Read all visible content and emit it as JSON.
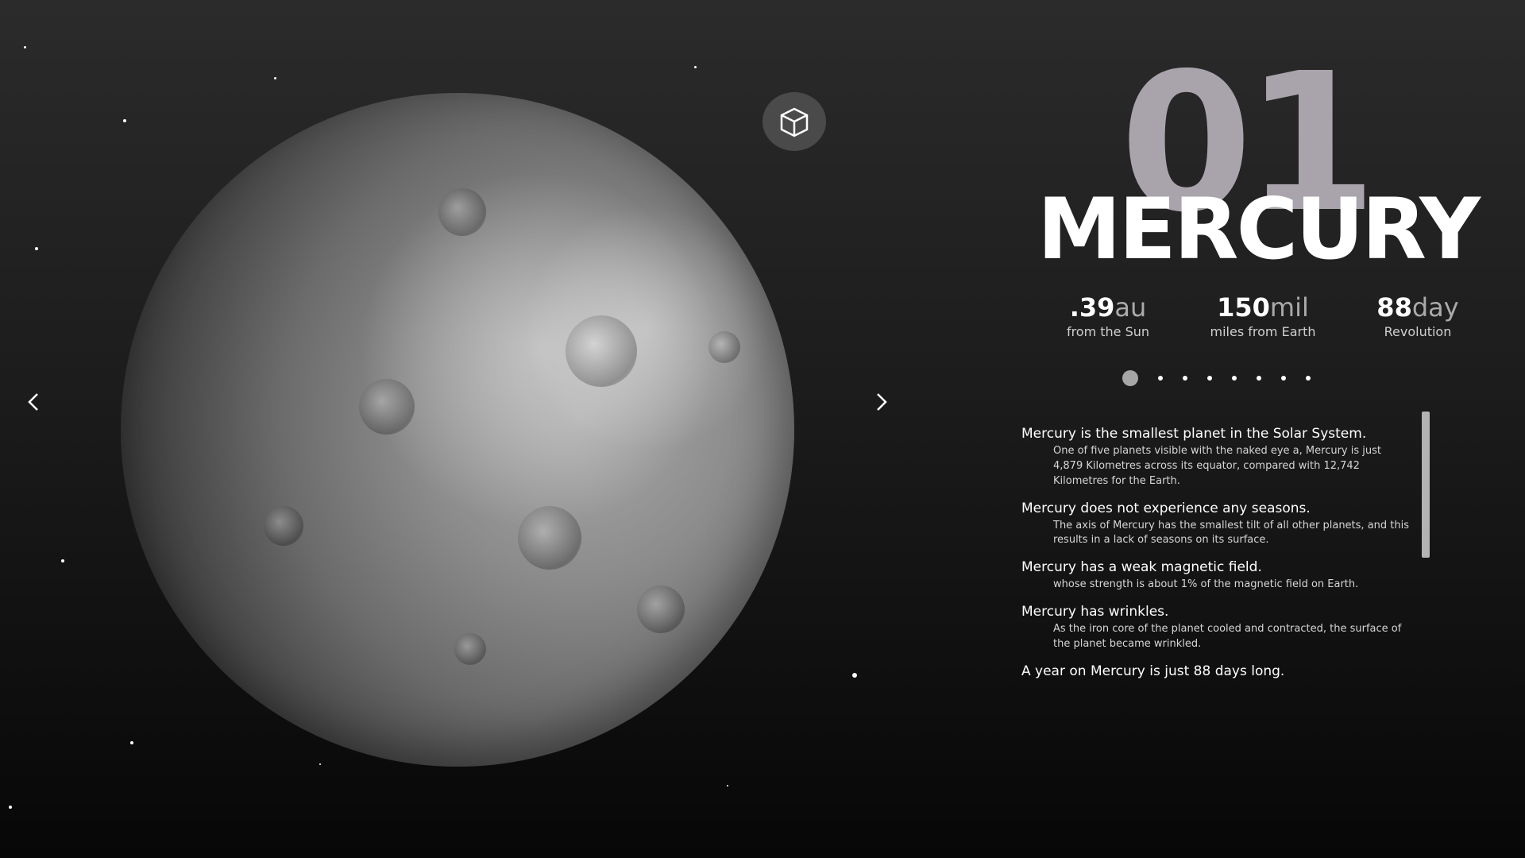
{
  "planet": {
    "number": "01",
    "name": "MERCURY"
  },
  "stats": [
    {
      "value": ".39",
      "unit": "au",
      "label": "from the Sun"
    },
    {
      "value": "150",
      "unit": "mil",
      "label": "miles from Earth"
    },
    {
      "value": "88",
      "unit": "day",
      "label": "Revolution"
    }
  ],
  "view_toggle": {
    "label": "3D",
    "icon": "cube-3d-icon"
  },
  "nav": {
    "prev_icon": "chevron-left-icon",
    "next_icon": "chevron-right-icon"
  },
  "pagination": {
    "total": 8,
    "active": 1
  },
  "facts": [
    {
      "title": "Mercury is the smallest planet in the Solar System.",
      "desc": "One of five planets visible with the naked eye a, Mercury is just 4,879 Kilometres across its equator, compared with 12,742 Kilometres for the Earth."
    },
    {
      "title": "Mercury does not experience any seasons.",
      "desc": "The axis of Mercury has the smallest tilt of all other planets, and this results in a lack of seasons on its surface."
    },
    {
      "title": "Mercury has a weak magnetic field.",
      "desc": "whose strength is about 1% of the magnetic field on Earth."
    },
    {
      "title": "Mercury has wrinkles.",
      "desc": "As the iron core of the planet cooled and contracted, the surface of the planet became wrinkled."
    },
    {
      "title": "A year on Mercury is just 88 days long.",
      "desc": ""
    }
  ],
  "colors": {
    "background": "#1c1c1c",
    "number": "#a9a4ac",
    "accent": "#a6a6a6"
  }
}
